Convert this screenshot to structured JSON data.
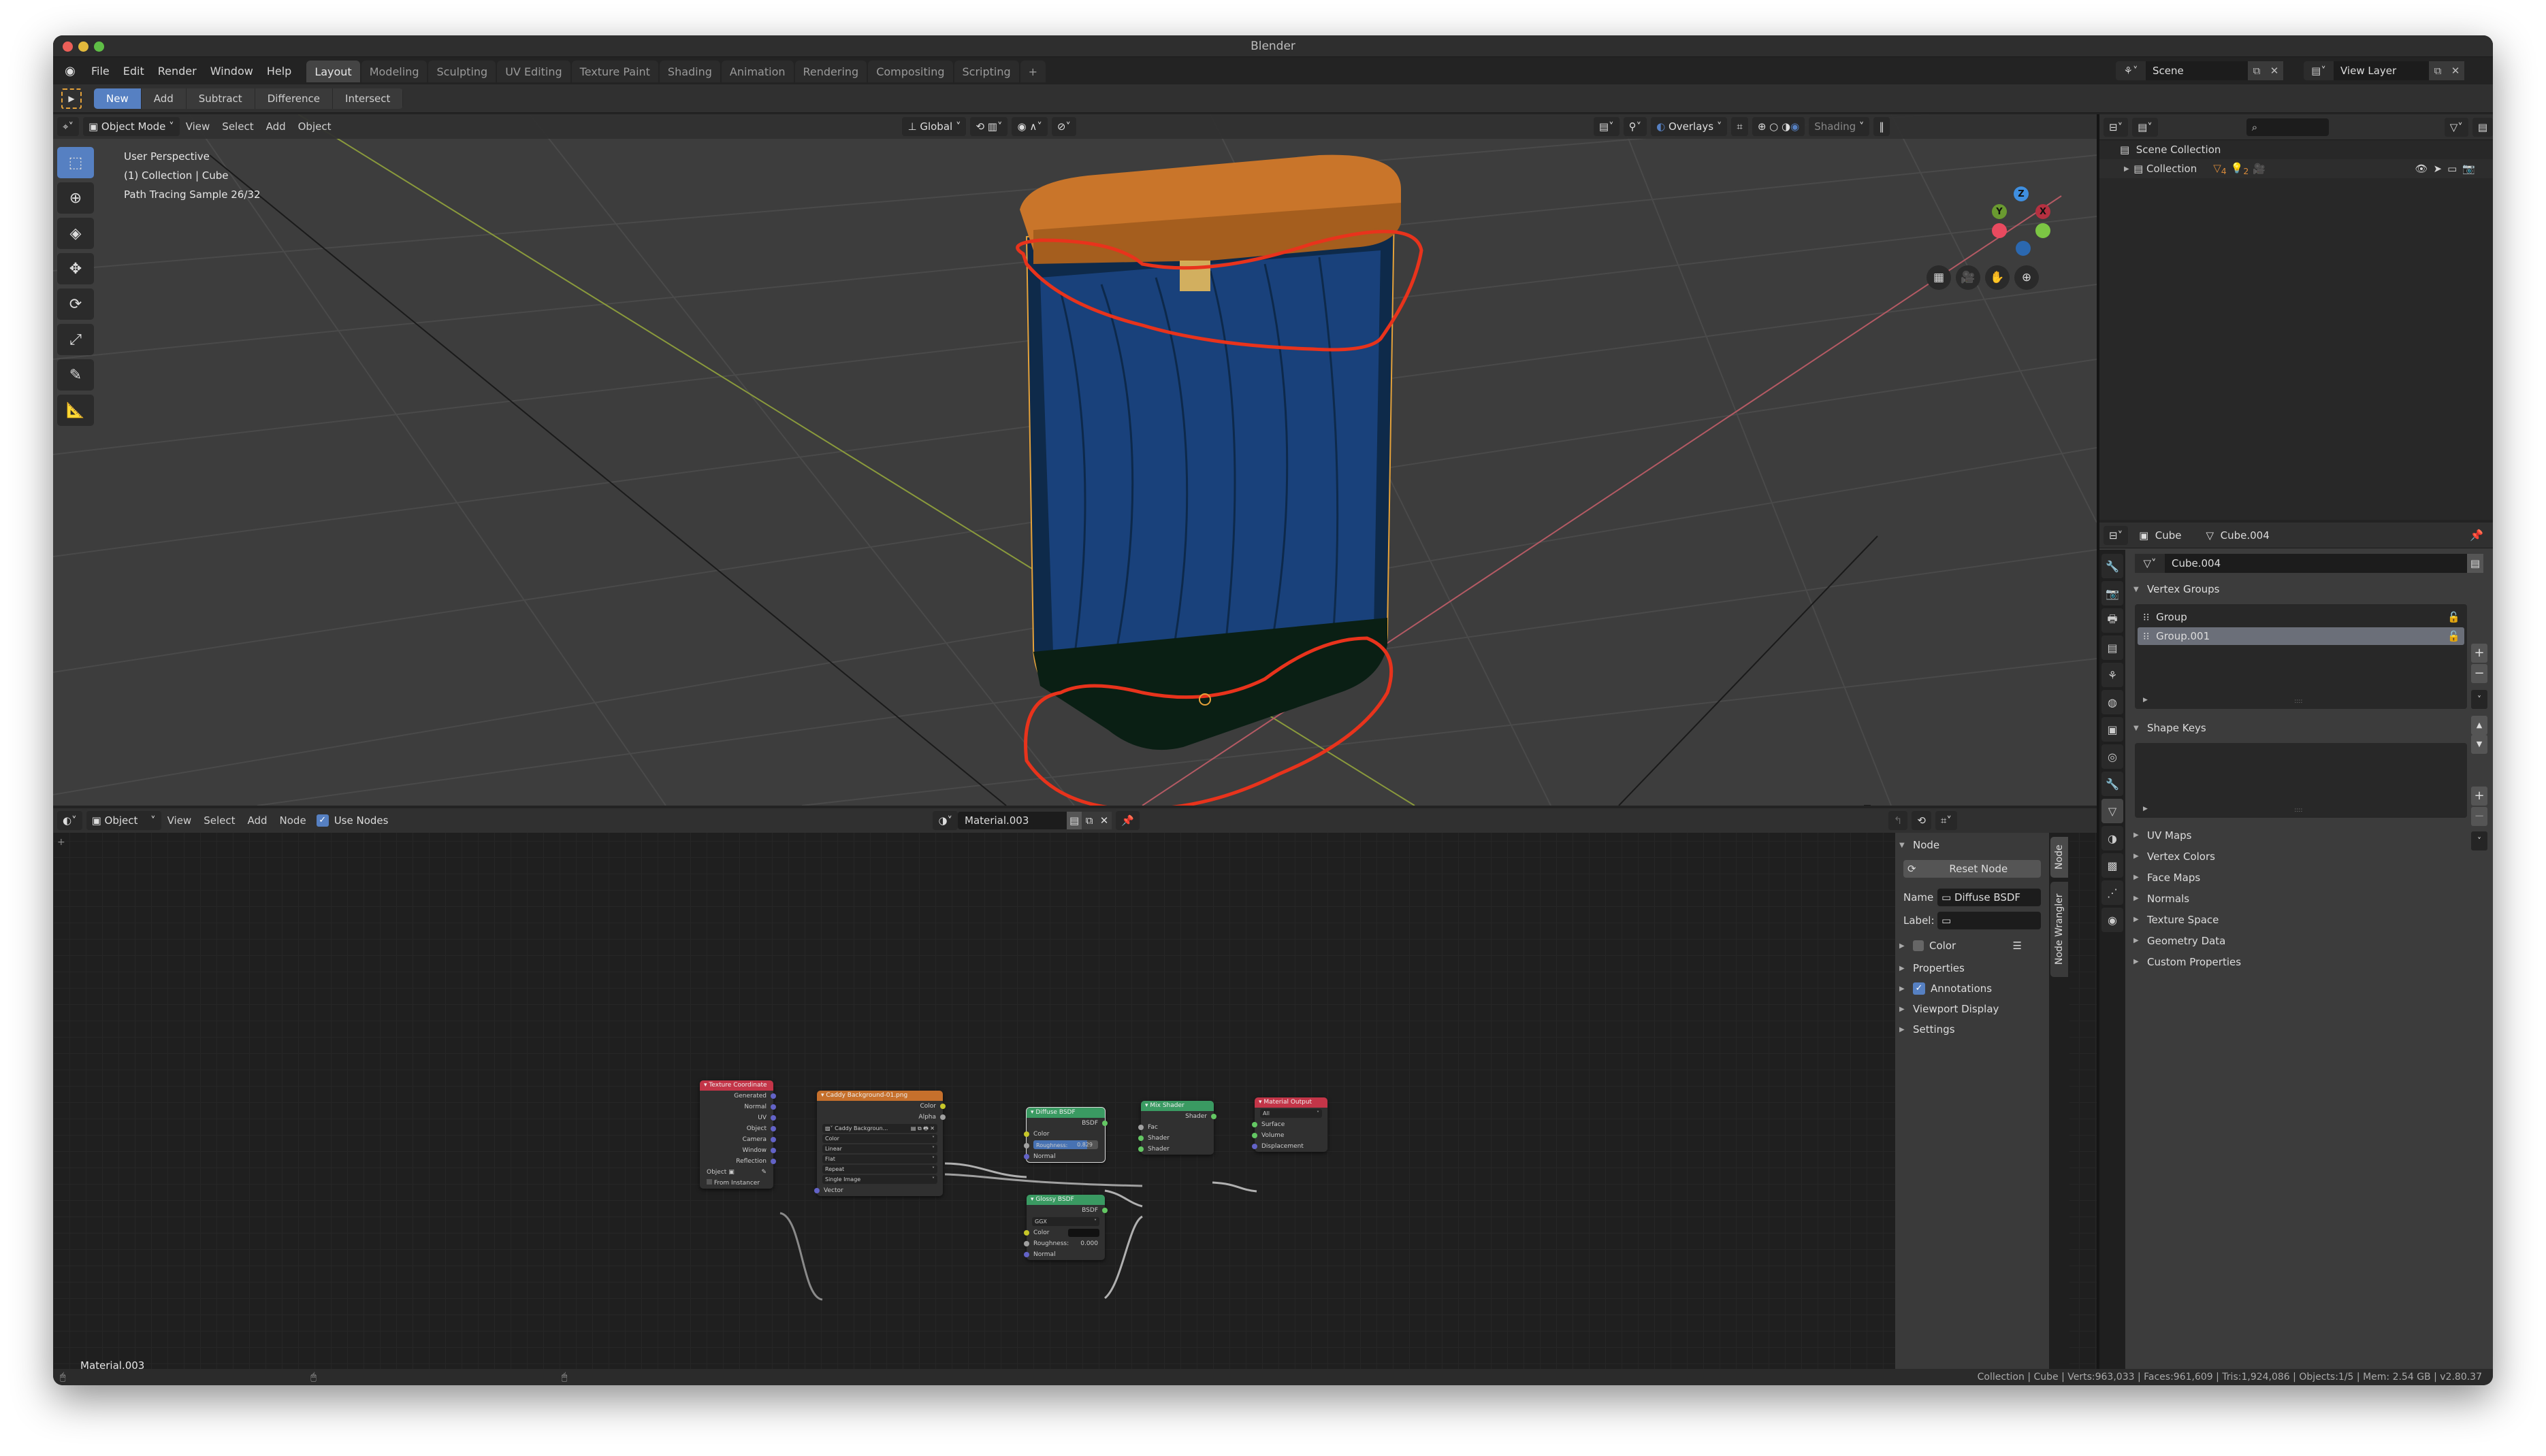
{
  "window": {
    "title": "Blender"
  },
  "menubar": {
    "items": [
      "File",
      "Edit",
      "Render",
      "Window",
      "Help"
    ],
    "workspaces": [
      "Layout",
      "Modeling",
      "Sculpting",
      "UV Editing",
      "Texture Paint",
      "Shading",
      "Animation",
      "Rendering",
      "Compositing",
      "Scripting"
    ],
    "active_workspace": "Layout",
    "add_workspace": "+",
    "scene": "Scene",
    "view_layer": "View Layer"
  },
  "tool_header": {
    "modes": [
      "New",
      "Add",
      "Subtract",
      "Difference",
      "Intersect"
    ],
    "active_mode": "New"
  },
  "viewport": {
    "mode": "Object Mode",
    "menus": [
      "View",
      "Select",
      "Add",
      "Object"
    ],
    "orientation": "Global",
    "overlays_label": "Overlays",
    "shading_label": "Shading",
    "info": [
      "User Perspective",
      "(1) Collection | Cube",
      "Path Tracing Sample 26/32"
    ],
    "axes": {
      "x": "X",
      "y": "Y",
      "z": "Z"
    },
    "colors": {
      "x_axis": "#e84a5f",
      "y_axis": "#7cc644",
      "z_axis": "#3f8fe0",
      "annotation": "#e8331c",
      "lid": "#c9752a",
      "body": "#1e4a8c"
    }
  },
  "outliner": {
    "search_placeholder": "",
    "scene_collection": "Scene Collection",
    "collection": "Collection",
    "badges": {
      "mesh_count": "4",
      "light_count": "2"
    }
  },
  "properties": {
    "object_name": "Cube",
    "mesh_name": "Cube.004",
    "data_field": "Cube.004",
    "vertex_groups_title": "Vertex Groups",
    "vertex_groups": [
      "Group",
      "Group.001"
    ],
    "selected_vertex_group": "Group.001",
    "shape_keys_title": "Shape Keys",
    "collapsed_sections": [
      "UV Maps",
      "Vertex Colors",
      "Face Maps",
      "Normals",
      "Texture Space",
      "Geometry Data",
      "Custom Properties"
    ]
  },
  "node_editor": {
    "type": "Object",
    "menus": [
      "View",
      "Select",
      "Add",
      "Node"
    ],
    "use_nodes_label": "Use Nodes",
    "use_nodes": true,
    "material": "Material.003",
    "material_label": "Material.003",
    "nodes": {
      "texcoord": {
        "title": "Texture Coordinate",
        "outputs": [
          "Generated",
          "Normal",
          "UV",
          "Object",
          "Camera",
          "Window",
          "Reflection"
        ],
        "object_label": "Object",
        "from_instancer": "From Instancer"
      },
      "image": {
        "title": "Caddy Background-01.png",
        "outputs": [
          "Color",
          "Alpha"
        ],
        "image_name": "Caddy Backgroun...",
        "dropdowns": [
          "Color",
          "Linear",
          "Flat",
          "Repeat",
          "Single Image"
        ],
        "input": "Vector"
      },
      "diffuse": {
        "title": "Diffuse BSDF",
        "output": "BSDF",
        "inputs": [
          "Color",
          "Normal"
        ],
        "roughness_label": "Roughness:",
        "roughness": "0.829",
        "roughness_fraction": 0.829
      },
      "glossy": {
        "title": "Glossy BSDF",
        "output": "BSDF",
        "distribution": "GGX",
        "color_label": "Color",
        "roughness_label": "Roughness:",
        "roughness": "0.000",
        "normal_label": "Normal"
      },
      "mix": {
        "title": "Mix Shader",
        "output": "Shader",
        "inputs": [
          "Fac",
          "Shader",
          "Shader"
        ]
      },
      "output": {
        "title": "Material Output",
        "target": "All",
        "inputs": [
          "Surface",
          "Volume",
          "Displacement"
        ]
      }
    },
    "sidebar": {
      "node_section": "Node",
      "reset_button": "Reset Node",
      "name_label": "Name",
      "name_value": "Diffuse BSDF",
      "label_label": "Label:",
      "label_value": "",
      "color_label": "Color",
      "properties_label": "Properties",
      "annotations_label": "Annotations",
      "viewport_display_label": "Viewport Display",
      "settings_label": "Settings",
      "tabs": [
        "Node",
        "Node Wrangler"
      ]
    }
  },
  "statusbar": {
    "text": "Collection | Cube | Verts:963,033 | Faces:961,609 | Tris:1,924,086 | Objects:1/5 | Mem: 2.54 GB | v2.80.37"
  }
}
